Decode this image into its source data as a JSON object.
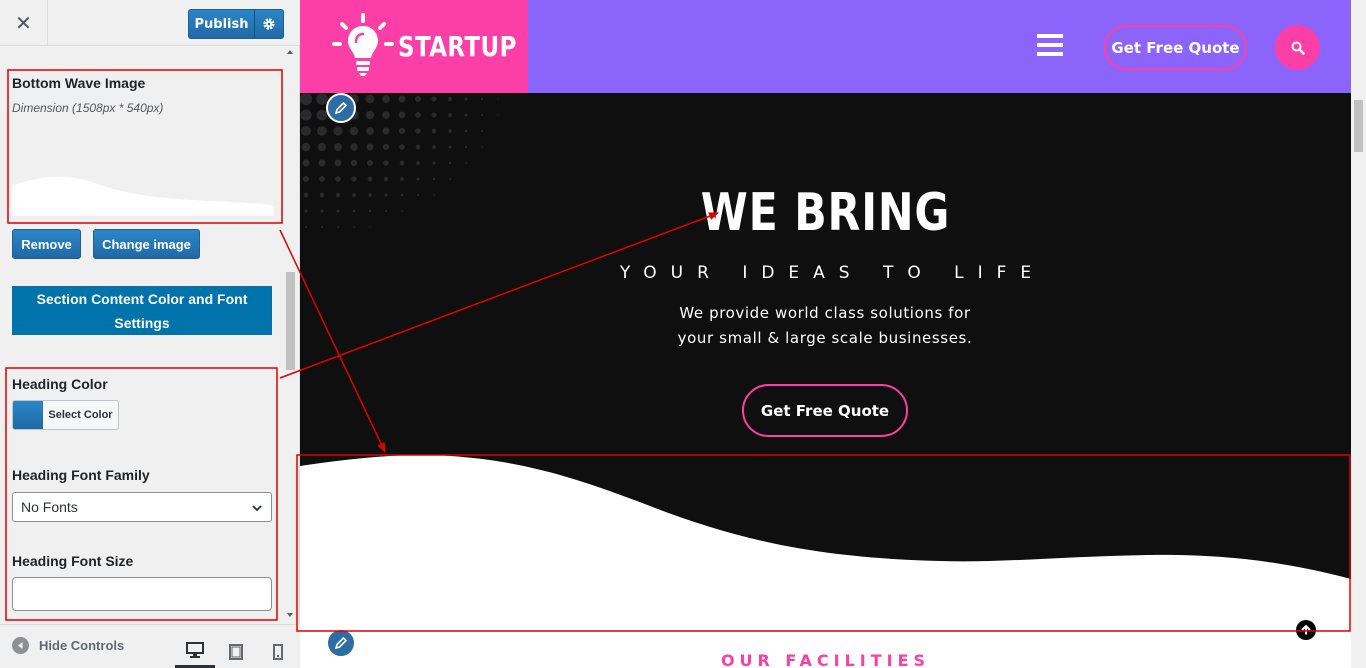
{
  "customizer": {
    "close_label": "✕",
    "publish_label": "Publish",
    "bottom_wave": {
      "title": "Bottom Wave Image",
      "dimension": "Dimension (1508px * 540px)",
      "remove_label": "Remove",
      "change_label": "Change image"
    },
    "section_settings_label": "Section Content Color and Font Settings",
    "heading_color": {
      "title": "Heading Color",
      "select_label": "Select Color",
      "swatch_color": "#2b80c0"
    },
    "heading_font_family": {
      "title": "Heading Font Family",
      "selected": "No Fonts"
    },
    "heading_font_size": {
      "title": "Heading Font Size",
      "value": ""
    },
    "footer": {
      "hide_controls_label": "Hide Controls"
    }
  },
  "site": {
    "logo_text": "STARTUP",
    "header_cta": "Get Free Quote",
    "hero": {
      "title": "WE BRING",
      "subtitle": "YOUR IDEAS TO LIFE",
      "description_line1": "We provide world class solutions for",
      "description_line2": "your small & large scale businesses.",
      "cta": "Get Free Quote"
    },
    "next_section_title": "OUR FACILITIES"
  },
  "colors": {
    "brand_pink": "#fc3fa6",
    "brand_purple": "#8b64fb",
    "hero_bg": "#0f0f10",
    "wp_blue": "#2271b1",
    "annotation_red": "#e00000"
  },
  "icons": {
    "publish_settings": "gear-icon",
    "search": "search-icon",
    "menu": "hamburger-icon",
    "logo": "lightbulb-icon",
    "edit": "pencil-icon",
    "scroll_top": "arrow-up-icon",
    "hide_controls": "arrow-left-circle-icon",
    "desktop": "desktop-icon",
    "tablet": "tablet-icon",
    "mobile": "mobile-icon"
  }
}
